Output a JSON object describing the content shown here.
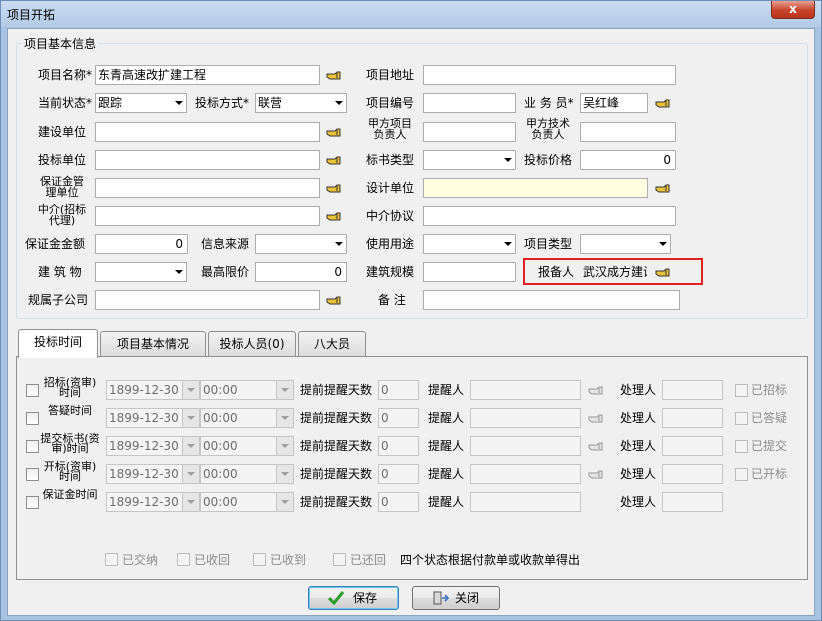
{
  "window": {
    "title": "项目开拓",
    "close": "x"
  },
  "basic": {
    "group_title": "项目基本信息",
    "proj_name_label": "项目名称*",
    "proj_name": "东青高速改扩建工程",
    "proj_addr_label": "项目地址",
    "proj_addr": "",
    "status_label": "当前状态*",
    "status": "跟踪",
    "bid_method_label": "投标方式*",
    "bid_method": "联营",
    "proj_no_label": "项目编号",
    "proj_no": "",
    "salesman_label": "业 务 员*",
    "salesman": "吴红峰",
    "builder_label": "建设单位",
    "builder": "",
    "owner_pm_label": "甲方项目负责人",
    "owner_pm": "",
    "owner_tech_label": "甲方技术负责人",
    "owner_tech": "",
    "bidder_label": "投标单位",
    "bidder": "",
    "doc_type_label": "标书类型",
    "doc_type": "",
    "bid_price_label": "投标价格",
    "bid_price": "0",
    "guarantor_label": "保证金管理单位",
    "guarantor": "",
    "designer_label": "设计单位",
    "designer": "",
    "agent_label": "中介(招标代理)",
    "agent": "",
    "agent_agreement_label": "中介协议",
    "agent_agreement": "",
    "deposit_label": "保证金金额",
    "deposit": "0",
    "info_source_label": "信息来源",
    "info_source": "",
    "usage_label": "使用用途",
    "usage": "",
    "proj_type_label": "项目类型",
    "proj_type": "",
    "building_label": "建 筑 物",
    "building": "",
    "max_price_label": "最高限价",
    "max_price": "0",
    "scale_label": "建筑规模",
    "scale": "",
    "reporter_label": "报备人",
    "reporter": "武汉成方建设",
    "subsidiary_label": "规属子公司",
    "subsidiary": "",
    "remark_label": "备 注",
    "remark": ""
  },
  "tabs": [
    "投标时间",
    "项目基本情况",
    "投标人员(0)",
    "八大员"
  ],
  "schedule": {
    "remind_days_label": "提前提醒天数",
    "reminder_label": "提醒人",
    "handler_label": "处理人",
    "rows": [
      {
        "label": "招标(资审)时间",
        "date": "1899-12-30",
        "time": "00:00",
        "days": "0",
        "done": "已招标"
      },
      {
        "label": "答疑时间",
        "date": "1899-12-30",
        "time": "00:00",
        "days": "0",
        "done": "已答疑"
      },
      {
        "label": "提交标书(资审)时间",
        "date": "1899-12-30",
        "time": "00:00",
        "days": "0",
        "done": "已提交"
      },
      {
        "label": "开标(资审)时间",
        "date": "1899-12-30",
        "time": "00:00",
        "days": "0",
        "done": "已开标"
      },
      {
        "label": "保证金时间",
        "date": "1899-12-30",
        "time": "00:00",
        "days": "0",
        "done": ""
      }
    ],
    "status_checks": [
      "已交纳",
      "已收回",
      "已收到",
      "已还回"
    ],
    "status_note": "四个状态根据付款单或收款单得出"
  },
  "buttons": {
    "save": "保存",
    "close": "关闭"
  },
  "colors": {
    "highlight_box": "#e02020",
    "designer_bg": "#ffffe1",
    "save_check": "#2e9d2e"
  }
}
